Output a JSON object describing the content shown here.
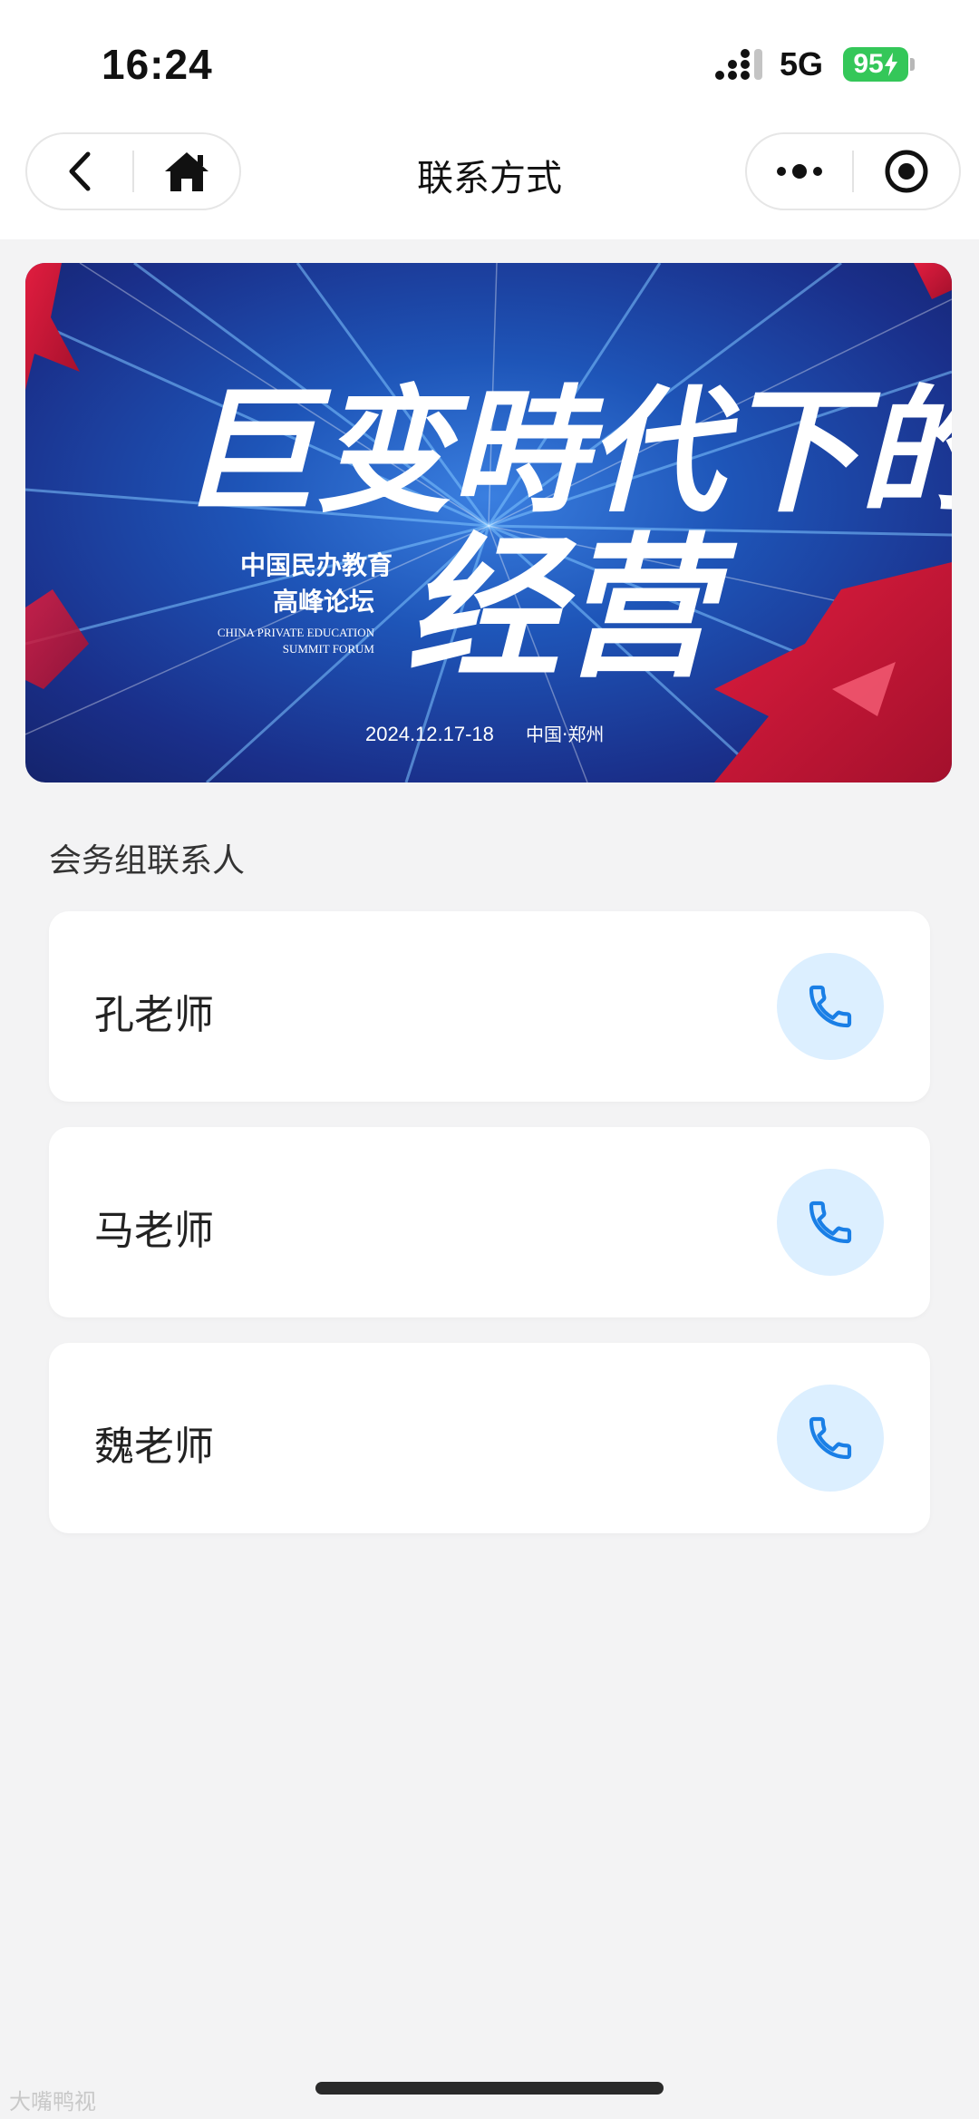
{
  "status_bar": {
    "time": "16:24",
    "network": "5G",
    "battery": "95"
  },
  "nav": {
    "title": "联系方式",
    "back_icon": "chevron-left-icon",
    "home_icon": "home-icon",
    "more_icon": "more-dots-icon",
    "close_icon": "target-circle-icon"
  },
  "banner": {
    "headline_line1": "巨变時代下的",
    "headline_line2": "经营",
    "event_cn_line1": "中国民办教育",
    "event_cn_line2": "高峰论坛",
    "event_en_line1": "CHINA PRIVATE EDUCATION",
    "event_en_line2": "SUMMIT FORUM",
    "date": "2024.12.17-18",
    "location": "中国·郑州",
    "colors": {
      "deep_blue": "#1b2f86",
      "bright_blue": "#1b6fd6",
      "red": "#d3183a"
    }
  },
  "contacts": {
    "section_title": "会务组联系人",
    "items": [
      {
        "name": "孔老师",
        "icon": "phone-icon"
      },
      {
        "name": "马老师",
        "icon": "phone-icon"
      },
      {
        "name": "魏老师",
        "icon": "phone-icon"
      }
    ],
    "accent_color": "#1a7fe6",
    "button_bg": "#dcefff"
  },
  "watermark": "大嘴鸭视"
}
